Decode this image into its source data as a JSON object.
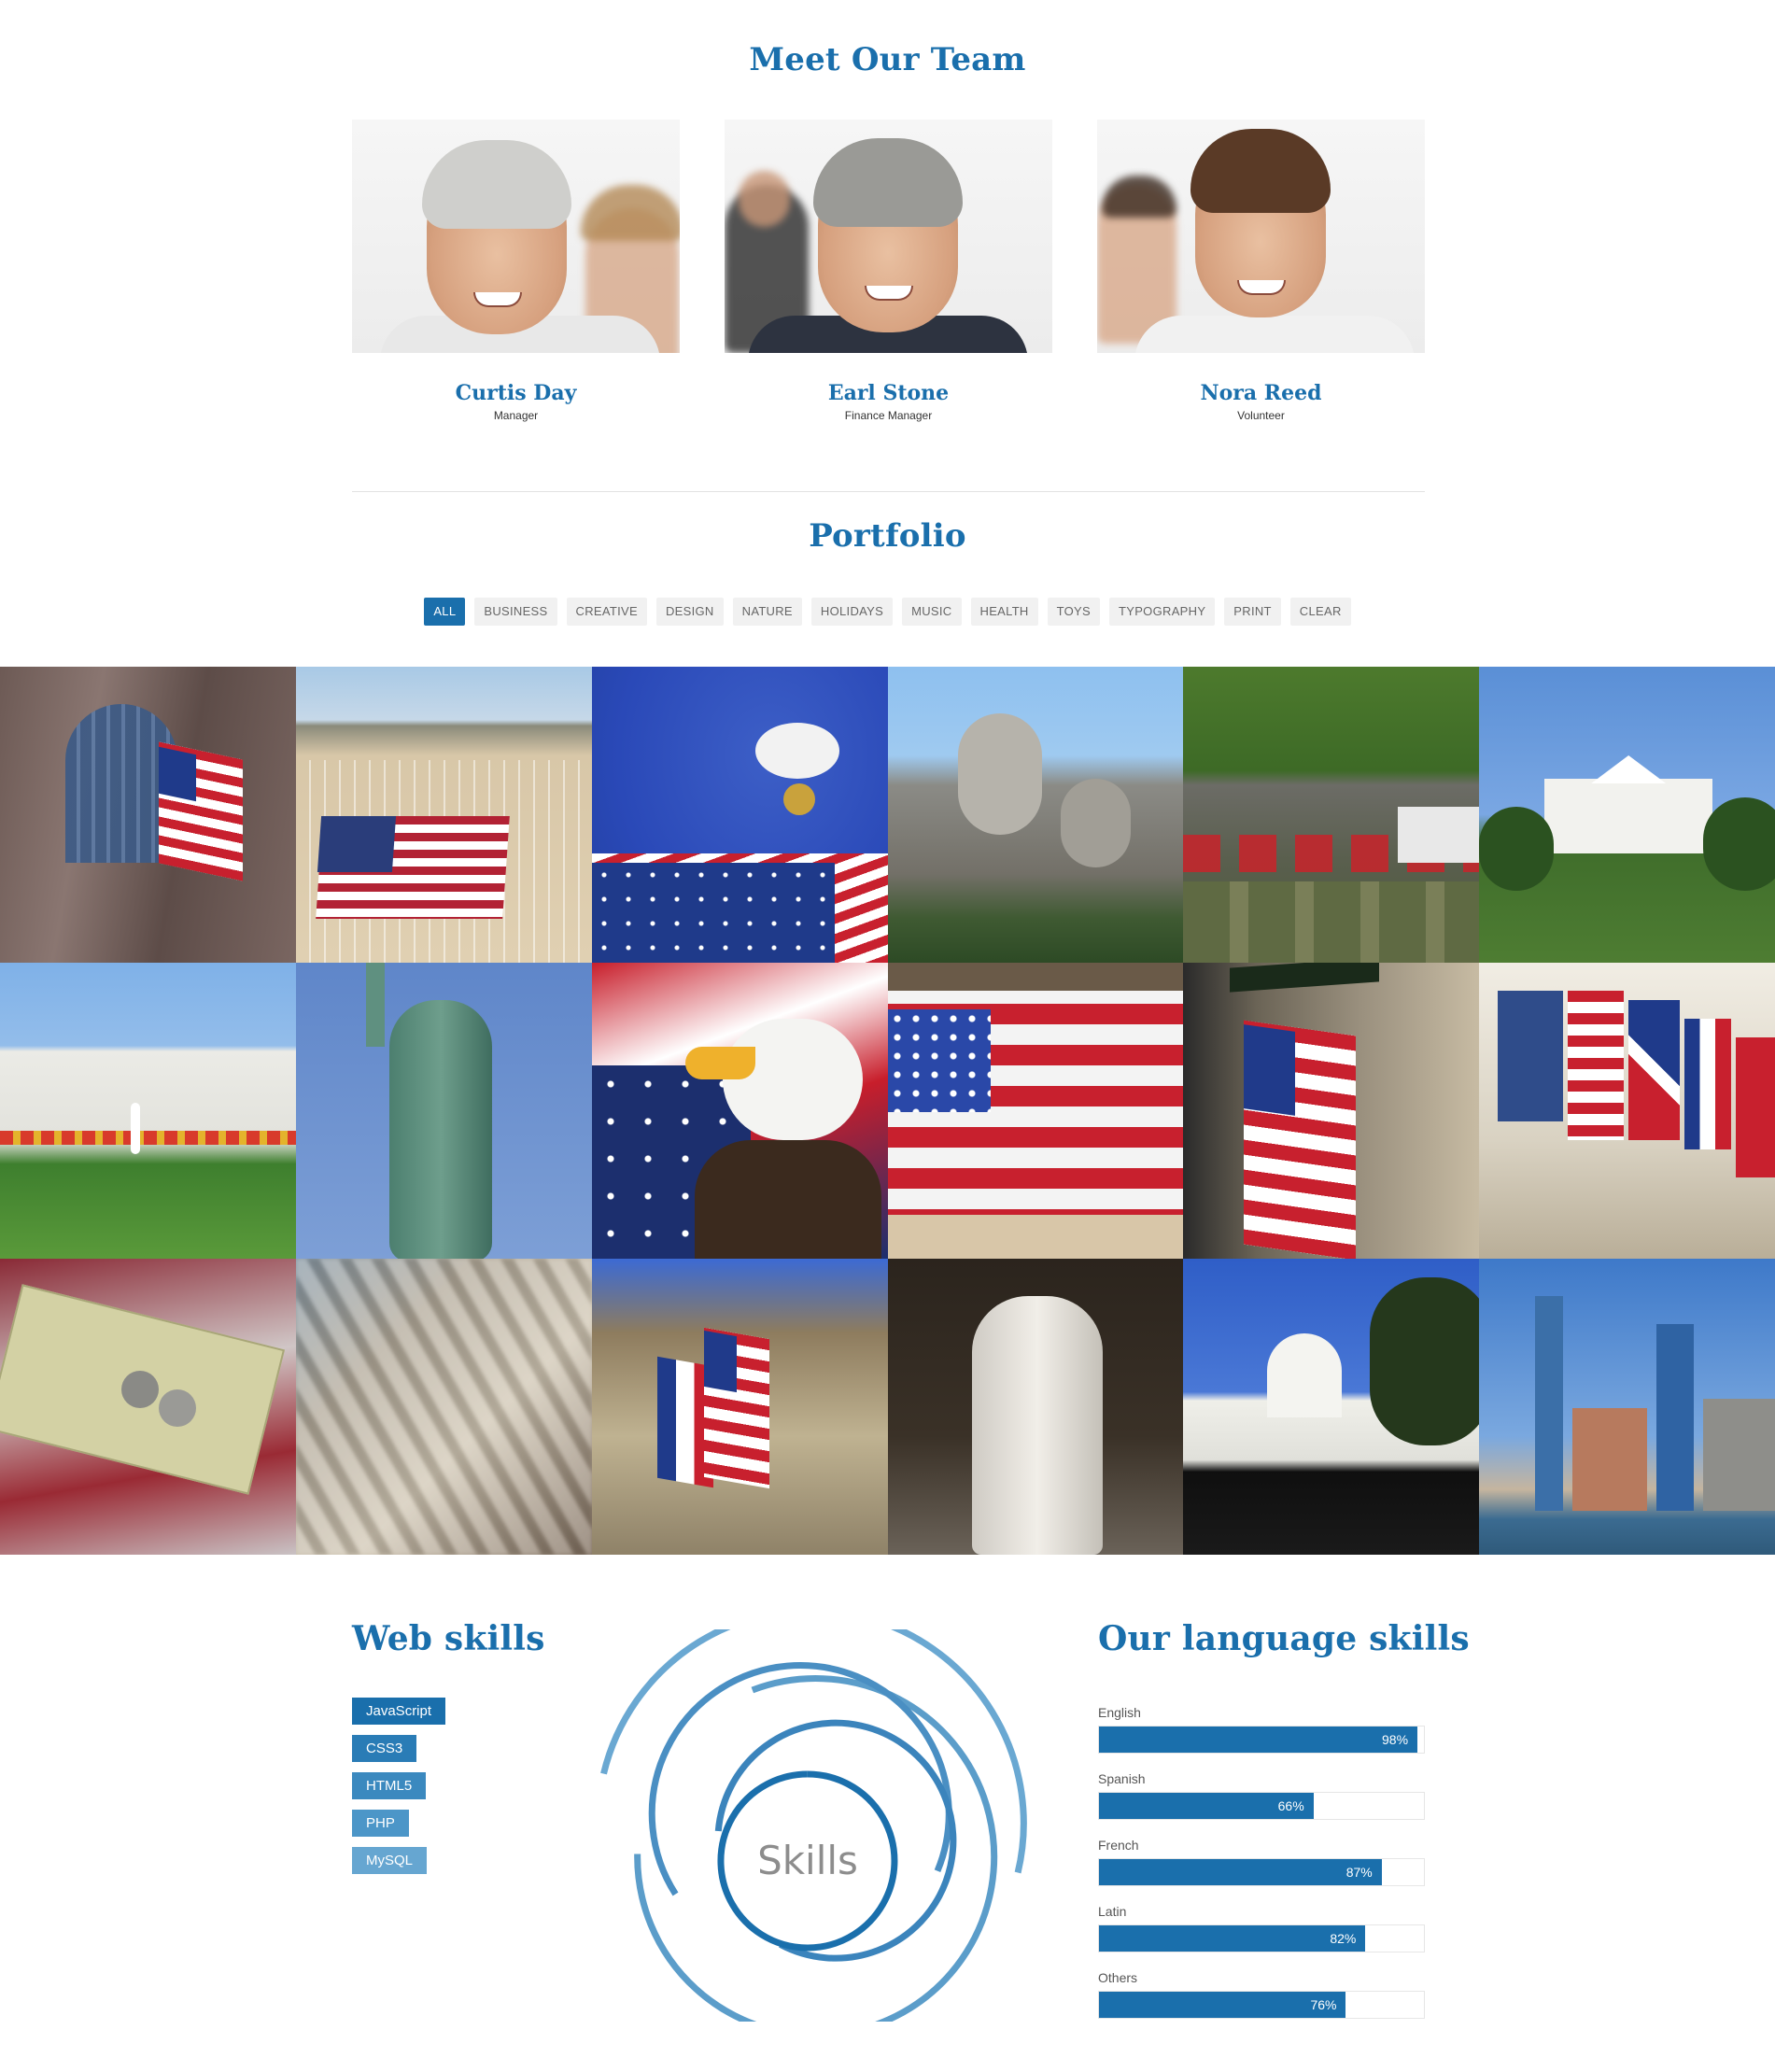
{
  "colors": {
    "accent": "#1a6fac",
    "filter_bg": "#f1f1f1",
    "divider": "#e2e2e2"
  },
  "team": {
    "title": "Meet Our Team",
    "members": [
      {
        "name": "Curtis Day",
        "role": "Manager"
      },
      {
        "name": "Earl Stone",
        "role": "Finance Manager"
      },
      {
        "name": "Nora Reed",
        "role": "Volunteer"
      }
    ]
  },
  "portfolio": {
    "title": "Portfolio",
    "filters": [
      "All",
      "Business",
      "Creative",
      "Design",
      "Nature",
      "Holidays",
      "Music",
      "Health",
      "Toys",
      "Typography",
      "Print",
      "Clear"
    ],
    "active_filter": "All",
    "items": [
      "cathedral-flag",
      "beach-flag-crosses",
      "seagull-flag",
      "mount-rushmore",
      "soldiers-ceremony",
      "white-house-north",
      "white-house-fountain",
      "statue-of-liberty",
      "eagle-flag",
      "flag-stock-exchange",
      "wall-street-flags",
      "nato-flags-building",
      "dollars-on-flag",
      "city-tilt-shift",
      "french-american-flags",
      "lincoln-memorial",
      "us-capitol",
      "new-york-skyline"
    ]
  },
  "web_skills": {
    "title": "Web skills",
    "tags": [
      {
        "label": "JavaScript",
        "color": "#1a6fac"
      },
      {
        "label": "CSS3",
        "color": "#2a7cb6"
      },
      {
        "label": "HTML5",
        "color": "#3b89bf"
      },
      {
        "label": "PHP",
        "color": "#4c96c8"
      },
      {
        "label": "MySQL",
        "color": "#66a6d1"
      }
    ],
    "circle_label": "Skills"
  },
  "language_skills": {
    "title": "Our language skills",
    "items": [
      {
        "label": "English",
        "value": 98,
        "text": "98%"
      },
      {
        "label": "Spanish",
        "value": 66,
        "text": "66%"
      },
      {
        "label": "French",
        "value": 87,
        "text": "87%"
      },
      {
        "label": "Latin",
        "value": 82,
        "text": "82%"
      },
      {
        "label": "Others",
        "value": 76,
        "text": "76%"
      }
    ]
  }
}
